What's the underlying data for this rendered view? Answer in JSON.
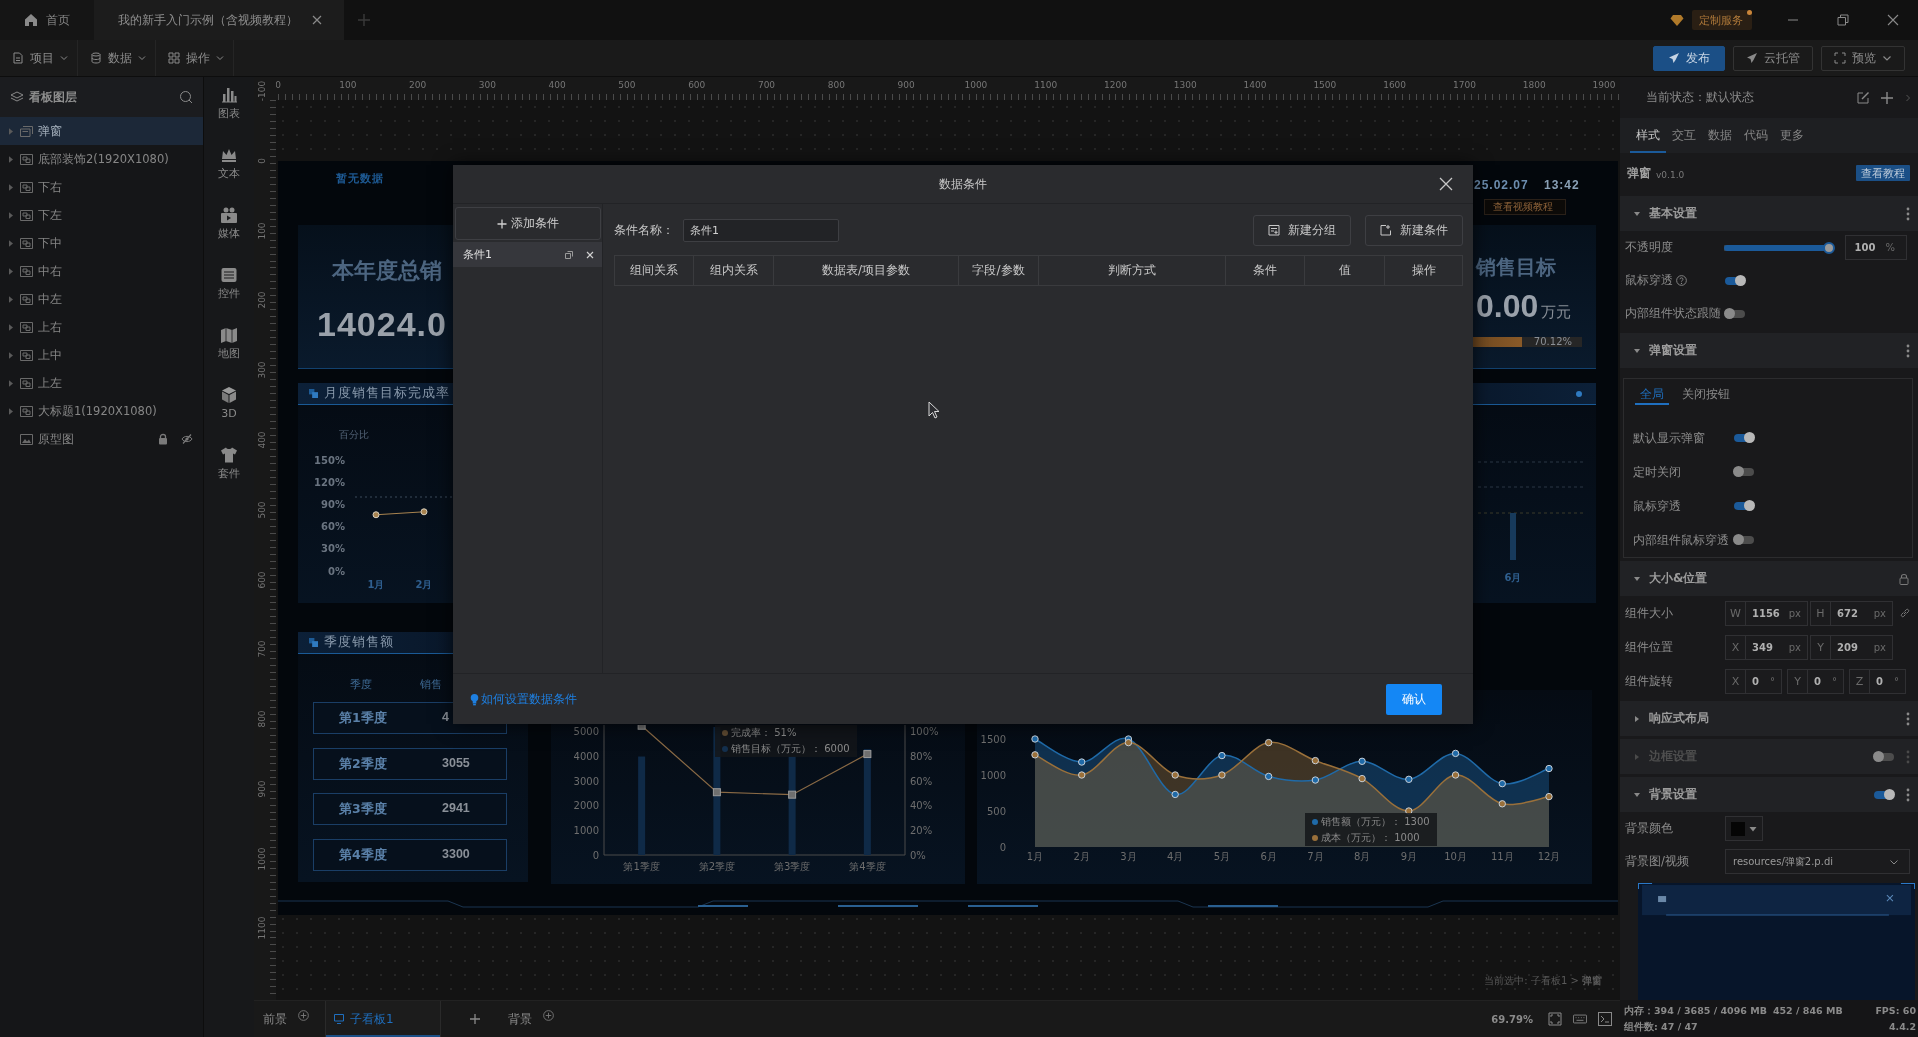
{
  "title_bar": {
    "tabs": [
      {
        "label": "首页",
        "kind": "home",
        "selected": false,
        "closable": false
      },
      {
        "label": "我的新手入门示例（含视频教程）",
        "kind": "document",
        "selected": true,
        "closable": true
      }
    ],
    "service_badge": "定制服务"
  },
  "menu_bar": {
    "menus": [
      {
        "label": "项目",
        "kind": "file"
      },
      {
        "label": "数据",
        "kind": "database"
      },
      {
        "label": "操作",
        "kind": "grid"
      }
    ],
    "actions": [
      {
        "label": "发布",
        "kind": "primary"
      },
      {
        "label": "云托管",
        "kind": "cloud"
      },
      {
        "label": "预览",
        "kind": "preview"
      }
    ]
  },
  "layers_panel": {
    "title": "看板图层",
    "items": [
      {
        "label": "弹窗",
        "kind": "popup",
        "expandable": true,
        "selected": true,
        "locked": false,
        "hidden": false
      },
      {
        "label": "底部装饰2(1920X1080)",
        "kind": "group",
        "expandable": true,
        "selected": false,
        "locked": false,
        "hidden": false
      },
      {
        "label": "下右",
        "kind": "group",
        "expandable": true,
        "selected": false,
        "locked": false,
        "hidden": false
      },
      {
        "label": "下左",
        "kind": "group",
        "expandable": true,
        "selected": false,
        "locked": false,
        "hidden": false
      },
      {
        "label": "下中",
        "kind": "group",
        "expandable": true,
        "selected": false,
        "locked": false,
        "hidden": false
      },
      {
        "label": "中右",
        "kind": "group",
        "expandable": true,
        "selected": false,
        "locked": false,
        "hidden": false
      },
      {
        "label": "中左",
        "kind": "group",
        "expandable": true,
        "selected": false,
        "locked": false,
        "hidden": false
      },
      {
        "label": "上右",
        "kind": "group",
        "expandable": true,
        "selected": false,
        "locked": false,
        "hidden": false
      },
      {
        "label": "上中",
        "kind": "group",
        "expandable": true,
        "selected": false,
        "locked": false,
        "hidden": false
      },
      {
        "label": "上左",
        "kind": "group",
        "expandable": true,
        "selected": false,
        "locked": false,
        "hidden": false
      },
      {
        "label": "大标题1(1920X1080)",
        "kind": "group",
        "expandable": true,
        "selected": false,
        "locked": false,
        "hidden": false
      },
      {
        "label": "原型图",
        "kind": "image",
        "expandable": false,
        "selected": false,
        "locked": true,
        "hidden": true
      }
    ]
  },
  "component_bar": {
    "items": [
      {
        "label": "图表",
        "kind": "chart"
      },
      {
        "label": "文本",
        "kind": "text"
      },
      {
        "label": "媒体",
        "kind": "media"
      },
      {
        "label": "控件",
        "kind": "control"
      },
      {
        "label": "地图",
        "kind": "map"
      },
      {
        "label": "3D",
        "kind": "cube"
      },
      {
        "label": "套件",
        "kind": "kit"
      }
    ]
  },
  "rulers": {
    "horizontal": [
      "0",
      "100",
      "200",
      "300",
      "400",
      "500",
      "600",
      "700",
      "800",
      "900",
      "1000",
      "1100",
      "1200",
      "1300",
      "1400",
      "1500",
      "1600",
      "1700",
      "1800",
      "1900"
    ],
    "vertical": [
      "-100",
      "0",
      "100",
      "200",
      "300",
      "400",
      "500",
      "600",
      "700",
      "800",
      "900",
      "1000",
      "1100"
    ]
  },
  "dashboard": {
    "no_data": "暂无数据",
    "date": "25.02.07",
    "time": "13:42",
    "video_button": "查看视频教程",
    "total_sales": {
      "title": "本年度总销",
      "value": "14024.0"
    },
    "sales_target": {
      "title": "销售目标",
      "value": "0.00",
      "unit": "万元",
      "progress": {
        "level": 0.7012,
        "reading": "70.12%"
      }
    },
    "monthly_rate": {
      "title": "月度销售目标完成率",
      "chart_data": {
        "type": "line",
        "ylabel": "百分比",
        "categories": [
          "1月",
          "2月"
        ],
        "series": [
          {
            "color": "#a8834f",
            "marker": "circle",
            "values": [
              76,
              80
            ]
          }
        ],
        "ylim": [
          0,
          150
        ],
        "yticks": [
          {
            "value": 0,
            "label": "0%"
          },
          {
            "value": 30,
            "label": "30%"
          },
          {
            "value": 60,
            "label": "60%"
          },
          {
            "value": 90,
            "label": "90%"
          },
          {
            "value": 120,
            "label": "120%"
          },
          {
            "value": 150,
            "label": "150%"
          }
        ],
        "ref_lines": [
          {
            "axis": "y",
            "value": 100
          }
        ]
      }
    },
    "side_chart": {
      "x_label": "6月"
    },
    "quarterly_sales": {
      "title": "季度销售额",
      "columns": [
        "季度",
        "销售"
      ],
      "rows": [
        [
          "第1季度",
          "4"
        ],
        [
          "第2季度",
          "3055"
        ],
        [
          "第3季度",
          "2941"
        ],
        [
          "第4季度",
          "3300"
        ]
      ]
    },
    "quarter_chart": {
      "chart_data": {
        "type": "bar",
        "categories": [
          "第1季度",
          "第2季度",
          "第3季度",
          "第4季度"
        ],
        "series": [
          {
            "type": "bar",
            "color": "#0f2a47",
            "values": [
              4000,
              5200,
              4000,
              4300
            ]
          },
          {
            "type": "line",
            "color": "#8a6a45",
            "marker": "square",
            "values": [
              5250,
              2550,
              2450,
              4100
            ]
          }
        ],
        "ylim": [
          0,
          5280
        ],
        "yticks": [
          0,
          1000,
          2000,
          3000,
          4000,
          5000
        ],
        "y2lim": [
          0,
          105.6
        ],
        "y2ticks": [
          {
            "value": 0,
            "label": "0%"
          },
          {
            "value": 20,
            "label": "20%"
          },
          {
            "value": 40,
            "label": "40%"
          },
          {
            "value": 60,
            "label": "60%"
          },
          {
            "value": 80,
            "label": "80%"
          },
          {
            "value": 100,
            "label": "100%"
          }
        ]
      },
      "tooltip": [
        {
          "text": "完成率： 51%",
          "color": "#5e4a32"
        },
        {
          "text": "销售目标（万元）： 6000",
          "color": "#14304e"
        }
      ]
    },
    "monthly_chart": {
      "chart_data": {
        "type": "area",
        "categories": [
          "1月",
          "2月",
          "3月",
          "4月",
          "5月",
          "6月",
          "7月",
          "8月",
          "9月",
          "10月",
          "11月",
          "12月"
        ],
        "series": [
          {
            "color": "#1f6aa8",
            "marker": "circle",
            "values": [
              1500,
              1180,
              1500,
              730,
              1270,
              980,
              930,
              1190,
              940,
              1300,
              880,
              1090
            ]
          },
          {
            "color": "#9a703a",
            "marker": "circle",
            "values": [
              1280,
              1000,
              1450,
              1000,
              1000,
              1450,
              1200,
              950,
              500,
              1000,
              600,
              700
            ]
          }
        ],
        "ylim": [
          0,
          1500
        ],
        "yticks": [
          0,
          500,
          1000,
          1500
        ]
      },
      "tooltip": [
        {
          "text": "销售额（万元）： 1300",
          "color": "#1f6aa8"
        },
        {
          "text": "成本（万元）： 1000",
          "color": "#9a703a"
        }
      ]
    }
  },
  "canvas": {
    "selection_path": "当前选中: 子看板1 > **弹窗**"
  },
  "bottom_bar": {
    "foreground": "前景",
    "boards": [
      {
        "label": "子看板1",
        "selected": true
      }
    ],
    "background": "背景",
    "zoom": "69.79%"
  },
  "properties_panel": {
    "state_label": "当前状态：默认状态",
    "tabs": [
      {
        "label": "样式",
        "selected": true
      },
      {
        "label": "交互",
        "selected": false
      },
      {
        "label": "数据",
        "selected": false
      },
      {
        "label": "代码",
        "selected": false
      },
      {
        "label": "更多",
        "selected": false
      }
    ],
    "component_name": "弹窗",
    "version": "v0.1.0",
    "tutorial_button": "查看教程",
    "sections": [
      {
        "title": "基本设置",
        "kind": "menu",
        "expanded": true,
        "disabled": false,
        "rows": [
          {
            "kind": "slider",
            "label": "不透明度",
            "level": 1,
            "value": "100",
            "unit": "%"
          },
          {
            "kind": "toggle",
            "label": "鼠标穿透",
            "help": true,
            "on": true
          },
          {
            "kind": "toggle",
            "label": "内部组件状态跟随",
            "help": false,
            "on": false
          }
        ]
      },
      {
        "title": "弹窗设置",
        "kind": "menu",
        "expanded": true,
        "disabled": false,
        "tabs": [
          {
            "label": "全局",
            "selected": true
          },
          {
            "label": "关闭按钮",
            "selected": false
          }
        ],
        "rows": [
          {
            "kind": "toggle",
            "label": "默认显示弹窗",
            "help": false,
            "on": true
          },
          {
            "kind": "toggle",
            "label": "定时关闭",
            "help": false,
            "on": false
          },
          {
            "kind": "toggle",
            "label": "鼠标穿透",
            "help": false,
            "on": true
          },
          {
            "kind": "toggle",
            "label": "内部组件鼠标穿透",
            "help": false,
            "on": false
          }
        ]
      },
      {
        "title": "大小&位置",
        "kind": "lock",
        "expanded": true,
        "disabled": false,
        "rows": [
          {
            "kind": "fields",
            "label": "组件大小",
            "link_button": true,
            "fields": [
              {
                "axis": "W",
                "value": "1156",
                "unit": "px"
              },
              {
                "axis": "H",
                "value": "672",
                "unit": "px"
              }
            ]
          },
          {
            "kind": "fields",
            "label": "组件位置",
            "link_button": false,
            "fields": [
              {
                "axis": "X",
                "value": "349",
                "unit": "px"
              },
              {
                "axis": "Y",
                "value": "209",
                "unit": "px"
              }
            ]
          },
          {
            "kind": "fields",
            "label": "组件旋转",
            "link_button": false,
            "fields": [
              {
                "axis": "X",
                "value": "0",
                "unit": "°"
              },
              {
                "axis": "Y",
                "value": "0",
                "unit": "°"
              },
              {
                "axis": "Z",
                "value": "0",
                "unit": "°"
              }
            ]
          }
        ]
      },
      {
        "title": "响应式布局",
        "kind": "menu",
        "expanded": false,
        "disabled": false
      },
      {
        "title": "边框设置",
        "kind": "menu",
        "expanded": false,
        "disabled": true,
        "toggle": false
      },
      {
        "title": "背景设置",
        "kind": "menu",
        "expanded": true,
        "disabled": false,
        "toggle": true,
        "rows": [
          {
            "kind": "color",
            "label": "背景颜色",
            "color": "#050505"
          },
          {
            "kind": "select",
            "label": "背景图/视频",
            "value": "resources/弹窗2.p.di"
          }
        ]
      }
    ]
  },
  "status_bar": {
    "memory": "内存：394 / 3685 / 4096 MB",
    "memory_2": "452 / 846 MB",
    "fps": "FPS: 60",
    "component_count": "组件数: 47 / 47",
    "version": "4.4.2"
  },
  "modal": {
    "title": "数据条件",
    "add_button": "添加条件",
    "conditions": [
      {
        "label": "条件1",
        "selected": true
      }
    ],
    "name_label": "条件名称：",
    "name_value": "条件1",
    "buttons": [
      {
        "label": "新建分组",
        "kind": "group"
      },
      {
        "label": "新建条件",
        "kind": "condition"
      }
    ],
    "columns": [
      "组间关系",
      "组内关系",
      "数据表/项目参数",
      "字段/参数",
      "判断方式",
      "条件",
      "值",
      "操作"
    ],
    "help_link": "如何设置数据条件",
    "confirm": "确认"
  }
}
